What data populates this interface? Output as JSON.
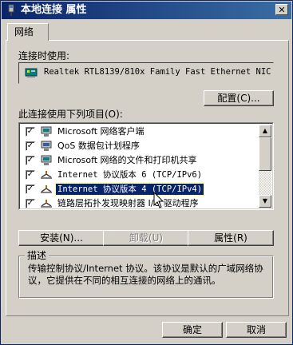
{
  "window": {
    "title": "本地连接 属性",
    "close_glyph": "✕"
  },
  "tabs": [
    {
      "label": "网络"
    }
  ],
  "connect_using": {
    "label": "连接时使用:",
    "adapter": "Realtek RTL8139/810x Family Fast Ethernet NIC",
    "configure_button": "配置(C)..."
  },
  "items_section": {
    "label": "此连接使用下列项目(O):",
    "items": [
      {
        "label": "Microsoft 网络客户端",
        "checked": true,
        "icon": "network-client-icon"
      },
      {
        "label": "QoS 数据包计划程序",
        "checked": true,
        "icon": "qos-icon"
      },
      {
        "label": "Microsoft 网络的文件和打印机共享",
        "checked": true,
        "icon": "file-share-icon"
      },
      {
        "label": "Internet 协议版本 6 (TCP/IPv6)",
        "checked": true,
        "icon": "protocol-icon"
      },
      {
        "label": "Internet 协议版本 4 (TCP/IPv4)",
        "checked": true,
        "icon": "protocol-icon",
        "selected": true
      },
      {
        "label": "链路层拓扑发现映射器 I/O 驱动程序",
        "checked": true,
        "icon": "protocol-icon"
      }
    ],
    "checkmark": "✓"
  },
  "actions": {
    "install": "安装(N)...",
    "uninstall": "卸载(U)",
    "properties": "属性(R)"
  },
  "description": {
    "title": "描述",
    "text": "传输控制协议/Internet 协议。该协议是默认的广域网络协议，它提供在不同的相互连接的网络上的通讯。"
  },
  "footer": {
    "ok": "确定",
    "cancel": "取消"
  },
  "colors": {
    "titlebar_start": "#0a246a",
    "titlebar_end": "#3a6ea5",
    "face": "#d4d0c8",
    "selection": "#0a246a"
  }
}
